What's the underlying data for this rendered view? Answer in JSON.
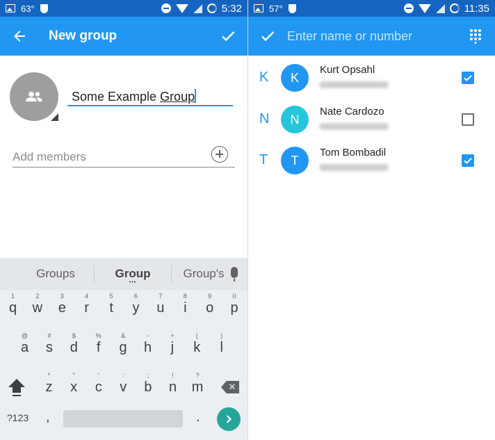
{
  "left": {
    "status": {
      "temperature": "63°",
      "time": "5:32"
    },
    "toolbar": {
      "title": "New group",
      "back_icon": "arrow-left-icon",
      "confirm_icon": "check-icon"
    },
    "group": {
      "name_value": "Some Example ",
      "name_underlined": "Group",
      "avatar_icon": "group-icon"
    },
    "members": {
      "placeholder": "Add members",
      "add_icon": "add-circle-icon"
    },
    "keyboard": {
      "suggestions": [
        "Groups",
        "Group",
        "Group's"
      ],
      "row1": [
        {
          "c": "q",
          "h": "1"
        },
        {
          "c": "w",
          "h": "2"
        },
        {
          "c": "e",
          "h": "3"
        },
        {
          "c": "r",
          "h": "4"
        },
        {
          "c": "t",
          "h": "5"
        },
        {
          "c": "y",
          "h": "6"
        },
        {
          "c": "u",
          "h": "7"
        },
        {
          "c": "i",
          "h": "8"
        },
        {
          "c": "o",
          "h": "9"
        },
        {
          "c": "p",
          "h": "0"
        }
      ],
      "row2": [
        {
          "c": "a",
          "h": "@"
        },
        {
          "c": "s",
          "h": "#"
        },
        {
          "c": "d",
          "h": "$"
        },
        {
          "c": "f",
          "h": "%"
        },
        {
          "c": "g",
          "h": "&"
        },
        {
          "c": "h",
          "h": "-"
        },
        {
          "c": "j",
          "h": "+"
        },
        {
          "c": "k",
          "h": "("
        },
        {
          "c": "l",
          "h": ")"
        }
      ],
      "row3": [
        {
          "c": "z",
          "h": "*"
        },
        {
          "c": "x",
          "h": "\""
        },
        {
          "c": "c",
          "h": "'"
        },
        {
          "c": "v",
          "h": ":"
        },
        {
          "c": "b",
          "h": ";"
        },
        {
          "c": "n",
          "h": "!"
        },
        {
          "c": "m",
          "h": "?"
        }
      ],
      "sym_label": "?123",
      "comma": ",",
      "period": "."
    }
  },
  "right": {
    "status": {
      "temperature": "57°",
      "time": "11:35"
    },
    "toolbar": {
      "search_placeholder": "Enter name or number",
      "confirm_icon": "check-icon",
      "dialpad_icon": "dialpad-icon"
    },
    "contacts": [
      {
        "section": "K",
        "initial": "K",
        "name": "Kurt Opsahl",
        "checked": true,
        "color": "#2196f3"
      },
      {
        "section": "N",
        "initial": "N",
        "name": "Nate Cardozo",
        "checked": false,
        "color": "#26c6da"
      },
      {
        "section": "T",
        "initial": "T",
        "name": "Tom Bombadil",
        "checked": true,
        "color": "#2196f3"
      }
    ]
  }
}
